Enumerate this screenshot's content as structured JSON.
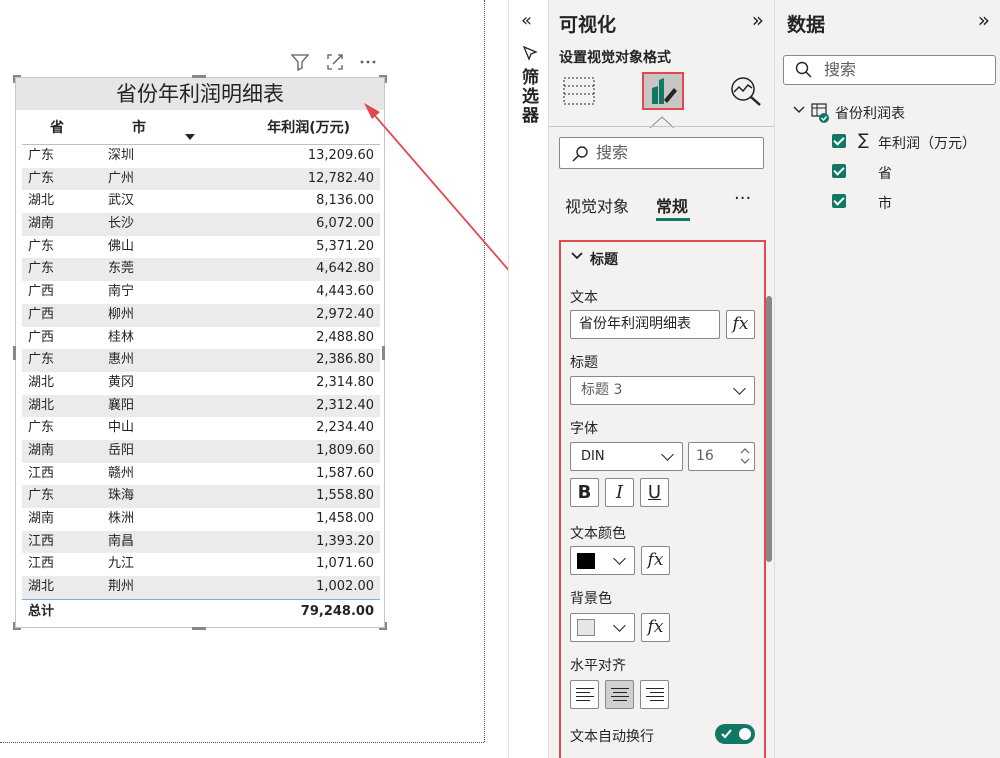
{
  "table_visual": {
    "title": "省份年利润明细表",
    "columns": [
      "省",
      "市",
      "年利润(万元)"
    ],
    "rows": [
      [
        "广东",
        "深圳",
        "13,209.60"
      ],
      [
        "广东",
        "广州",
        "12,782.40"
      ],
      [
        "湖北",
        "武汉",
        "8,136.00"
      ],
      [
        "湖南",
        "长沙",
        "6,072.00"
      ],
      [
        "广东",
        "佛山",
        "5,371.20"
      ],
      [
        "广东",
        "东莞",
        "4,642.80"
      ],
      [
        "广西",
        "南宁",
        "4,443.60"
      ],
      [
        "广西",
        "柳州",
        "2,972.40"
      ],
      [
        "广西",
        "桂林",
        "2,488.80"
      ],
      [
        "广东",
        "惠州",
        "2,386.80"
      ],
      [
        "湖北",
        "黄冈",
        "2,314.80"
      ],
      [
        "湖北",
        "襄阳",
        "2,312.40"
      ],
      [
        "广东",
        "中山",
        "2,234.40"
      ],
      [
        "湖南",
        "岳阳",
        "1,809.60"
      ],
      [
        "江西",
        "赣州",
        "1,587.60"
      ],
      [
        "广东",
        "珠海",
        "1,558.80"
      ],
      [
        "湖南",
        "株洲",
        "1,458.00"
      ],
      [
        "江西",
        "南昌",
        "1,393.20"
      ],
      [
        "江西",
        "九江",
        "1,071.60"
      ],
      [
        "湖北",
        "荆州",
        "1,002.00"
      ]
    ],
    "total_label": "总计",
    "total_value": "79,248.00"
  },
  "filters": {
    "label": "筛选器"
  },
  "visualizations": {
    "title": "可视化",
    "subtitle": "设置视觉对象格式",
    "search_placeholder": "搜索",
    "tabs": [
      "视觉对象",
      "常规"
    ],
    "active_tab": "常规",
    "more": "···",
    "section": {
      "name": "标题",
      "text_label": "文本",
      "text_value": "省份年利润明细表",
      "heading_label": "标题",
      "heading_value": "标题 3",
      "font_label": "字体",
      "font_family": "DIN",
      "font_size": "16",
      "bold": "B",
      "italic": "I",
      "underline": "U",
      "font_color_label": "文本颜色",
      "font_color": "#000000",
      "bg_color_label": "背景色",
      "bg_color": "#e6e6e6",
      "align_label": "水平对齐",
      "wrap_label": "文本自动换行",
      "wrap_on": true,
      "fx": "fx"
    }
  },
  "data_pane": {
    "title": "数据",
    "search_placeholder": "搜索",
    "table_name": "省份利润表",
    "fields": [
      {
        "label": "年利润（万元）",
        "is_measure": true,
        "checked": true
      },
      {
        "label": "省",
        "is_measure": false,
        "checked": true
      },
      {
        "label": "市",
        "is_measure": false,
        "checked": true
      }
    ]
  },
  "colors": {
    "accent_red": "#e2484f",
    "brand_teal": "#117865",
    "selected_tab_underline": "#117865"
  }
}
